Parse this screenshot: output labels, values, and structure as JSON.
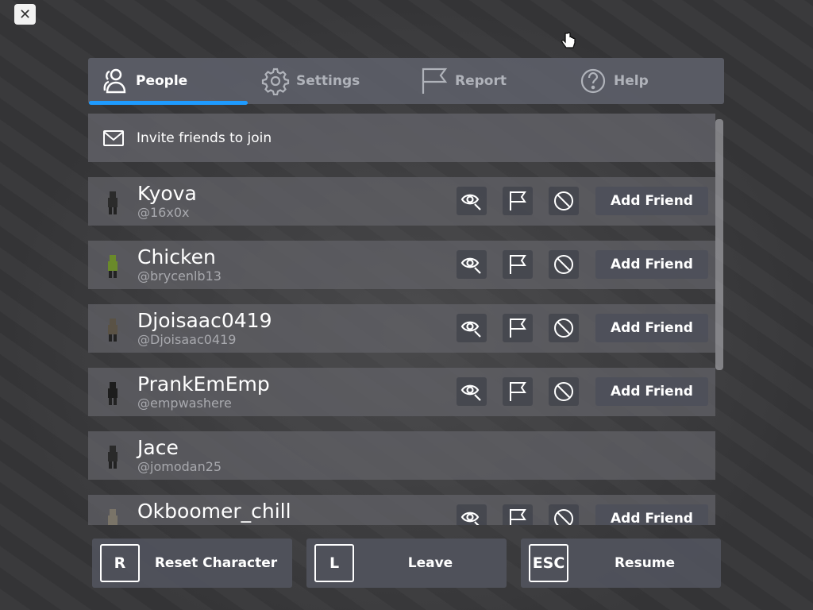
{
  "close_button": "✕",
  "tabs": [
    {
      "label": "People",
      "icon": "people-icon",
      "active": true
    },
    {
      "label": "Settings",
      "icon": "gear-icon",
      "active": false
    },
    {
      "label": "Report",
      "icon": "flag-icon",
      "active": false
    },
    {
      "label": "Help",
      "icon": "help-icon",
      "active": false
    }
  ],
  "invite": {
    "label": "Invite friends to join",
    "icon": "mail-icon"
  },
  "players": [
    {
      "display_name": "Kyova",
      "username": "@16x0x",
      "add_friend": "Add Friend",
      "has_actions": true
    },
    {
      "display_name": "Chicken",
      "username": "@brycenlb13",
      "add_friend": "Add Friend",
      "has_actions": true
    },
    {
      "display_name": "Djoisaac0419",
      "username": "@Djoisaac0419",
      "add_friend": "Add Friend",
      "has_actions": true
    },
    {
      "display_name": "PrankEmEmp",
      "username": "@empwashere",
      "add_friend": "Add Friend",
      "has_actions": true
    },
    {
      "display_name": "Jace",
      "username": "@jomodan25",
      "add_friend": "",
      "has_actions": false
    },
    {
      "display_name": "Okboomer_chill",
      "username": "",
      "add_friend": "Add Friend",
      "has_actions": true
    }
  ],
  "actions": [
    {
      "key": "R",
      "label": "Reset Character"
    },
    {
      "key": "L",
      "label": "Leave"
    },
    {
      "key": "ESC",
      "label": "Resume"
    }
  ],
  "colors": {
    "accent": "#1e9bff",
    "text": "#ffffff",
    "muted_text": "#a8a9ae"
  }
}
